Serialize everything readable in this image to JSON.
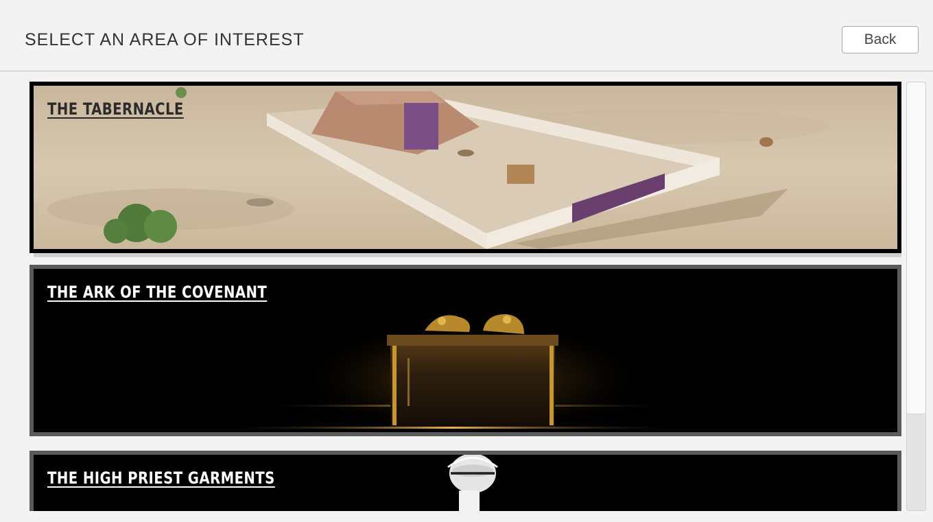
{
  "header": {
    "title": "SELECT AN AREA OF INTEREST",
    "back_label": "Back"
  },
  "cards": [
    {
      "title": "THE TABERNACLE"
    },
    {
      "title": "THE ARK OF THE COVENANT"
    },
    {
      "title": "THE HIGH PRIEST GARMENTS"
    }
  ],
  "colors": {
    "background": "#f3f3f3",
    "card_border_selected": "#000000",
    "card_border": "#5a5a5a",
    "sand": "#d6c6ae",
    "gold": "#c8962e"
  }
}
